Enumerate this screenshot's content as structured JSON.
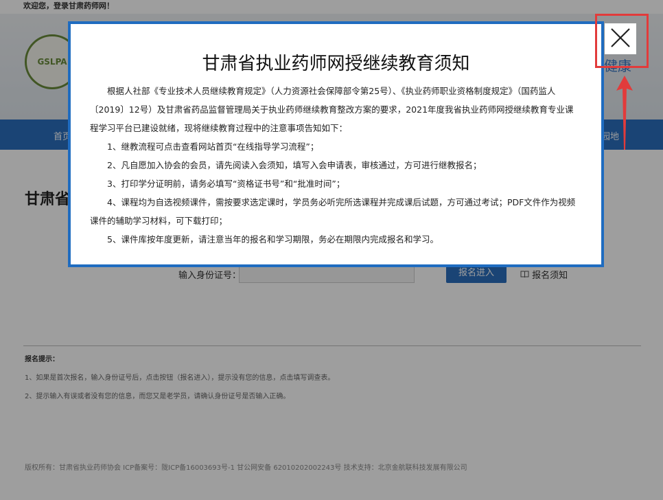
{
  "page": {
    "welcome": "欢迎您，登录甘肃药师网！",
    "logo_text": "GSLPA",
    "header_right": "健康",
    "nav_home": "首页",
    "nav_right": "园地",
    "heading": "甘肃省",
    "id_label": "输入身份证号：",
    "enter_button": "报名进入",
    "notice_link": "报名须知",
    "tips_title": "报名提示：",
    "tip1": "1、如果是首次报名，输入身份证号后，点击按钮（报名进入），提示没有您的信息，点击填写调查表。",
    "tip2": "2、提示输入有误或者没有您的信息，而您又是老学员，请确认身份证号是否输入正确。",
    "footer": "版权所有：甘肃省执业药师协会 ICP备案号：陇ICP备16003693号-1 甘公网安备 62010202002243号 技术支持：北京金航联科技发展有限公司"
  },
  "modal": {
    "title": "甘肃省执业药师网授继续教育须知",
    "intro": "根据人社部《专业技术人员继续教育规定》（人力资源社会保障部令第25号）、《执业药师职业资格制度规定》（国药监人〔2019〕12号）及甘肃省药品监督管理局关于执业药师继续教育整改方案的要求，2021年度我省执业药师网授继续教育专业课程学习平台已建设就绪，现将继续教育过程中的注意事项告知如下：",
    "items": [
      "1、继教流程可点击查看网站首页“在线指导学习流程”；",
      "2、凡自愿加入协会的会员，请先阅读入会须知，填写入会申请表，审核通过，方可进行继教报名；",
      "3、打印学分证明前，请务必填写“资格证书号”和“批准时间”；",
      "4、课程均为自选视频课件，需按要求选定课时，学员务必听完所选课程并完成课后试题，方可通过考试；PDF文件作为视频课件的辅助学习材料，可下载打印；",
      "5、课件库按年度更新，请注意当年的报名和学习期限，务必在期限内完成报名和学习。"
    ]
  },
  "colors": {
    "modal_border": "#1f6cc0",
    "annotation": "#e23b3b",
    "nav": "#2b6fbd"
  },
  "icons": {
    "close": "close-icon",
    "arrow": "arrow-up-icon",
    "book": "book-icon"
  }
}
